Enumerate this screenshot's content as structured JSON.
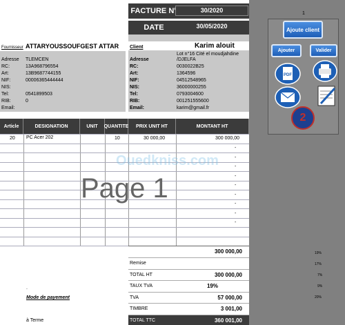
{
  "watermark": "Page 1",
  "brand_watermark": "Ouedkniss.com",
  "invoice": {
    "facture_label": "FACTURE N°",
    "facture_value": "30/2020",
    "date_label": "DATE",
    "date_value": "30/05/2020"
  },
  "supplier": {
    "label": "Fournisseur",
    "name": "ATTARYOUSSOUFGEST ATTAR",
    "rows": [
      {
        "k": "Adresse",
        "v": "TLEMCEN"
      },
      {
        "k": "RC:",
        "v": "13A968796554"
      },
      {
        "k": "Art:",
        "v": "13B9687744155"
      },
      {
        "k": "NIF:",
        "v": "00006365444444"
      },
      {
        "k": "NIS:",
        "v": ""
      },
      {
        "k": "Tel:",
        "v": "0541899503"
      },
      {
        "k": "RIB:",
        "v": "0"
      },
      {
        "k": "Email:",
        "v": ""
      }
    ]
  },
  "client": {
    "label": "Client",
    "name": "Karim alouit",
    "address_line1": "Lot n°16 Cité el moudjahdine",
    "rows": [
      {
        "k": "Adresse",
        "v": "/DJELFA"
      },
      {
        "k": "RC:",
        "v": "0030022B25"
      },
      {
        "k": "Art:",
        "v": "1364596"
      },
      {
        "k": "NIF:",
        "v": "04512548965"
      },
      {
        "k": "NIS:",
        "v": "36000000255"
      },
      {
        "k": "Tel:",
        "v": "0793004600"
      },
      {
        "k": "RIB:",
        "v": "001251555600"
      },
      {
        "k": "Email:",
        "v": "karim@gmail.fr"
      }
    ]
  },
  "table": {
    "headers": [
      "Article",
      "DESIGNATION",
      "UNIT",
      "QUANTITE",
      "PRIX UNIT HT",
      "MONTANT HT"
    ],
    "rows": [
      {
        "article": "20",
        "designation": "PC Acer 202",
        "unit": "",
        "qty": "10",
        "price": "30 000,00",
        "amount": "300 000,00"
      }
    ],
    "dashes": [
      "-",
      "-",
      "-",
      "-",
      "-",
      "-",
      "-",
      "-",
      "-"
    ]
  },
  "totals": {
    "subtotal": "300 000,00",
    "rows": [
      {
        "label": "Remise",
        "value": ""
      },
      {
        "label": "TOTAL HT",
        "value": "300 000,00"
      },
      {
        "label": "TAUX TVA",
        "value": "19%"
      },
      {
        "label": "TVA",
        "value": "57 000,00"
      },
      {
        "label": "TIMBRE",
        "value": "3 001,00"
      },
      {
        "label": "TOTAL TTC",
        "value": "360 001,00"
      }
    ]
  },
  "payment": {
    "dot": ".",
    "label": "Mode de payement",
    "value": "à Terme"
  },
  "side_panel": {
    "counter": "1",
    "add_client": "Ajoute client",
    "add": "Ajouter",
    "validate": "Valider",
    "pdf_label": "PDF",
    "badge": "2"
  },
  "percent_list": [
    "19%",
    "17%",
    "7%",
    "9%",
    "20%"
  ],
  "colors": {
    "header_dark": "#3b3b3b",
    "button_blue": "#1f5fb8",
    "badge_red": "#c0302a"
  }
}
